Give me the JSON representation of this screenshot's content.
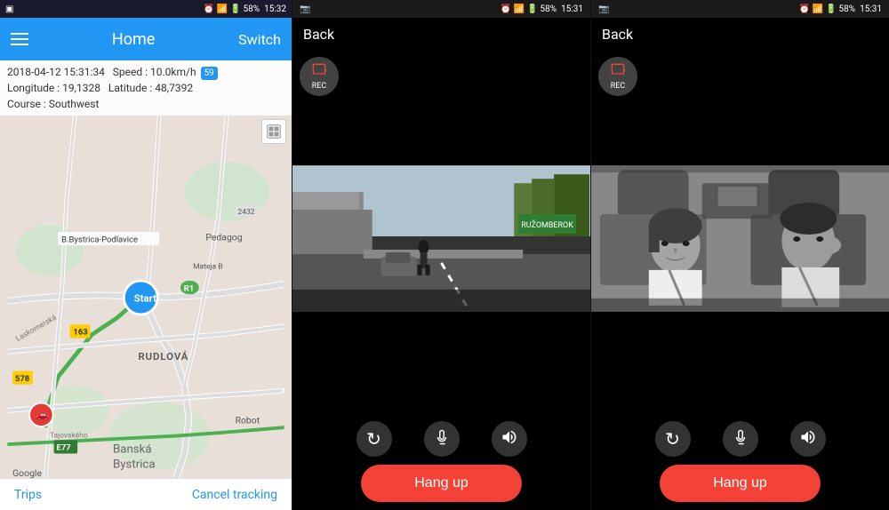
{
  "panel1": {
    "statusbar": {
      "left": "▣",
      "icons": "⏰ 📶 🔋 58%",
      "time": "15:32"
    },
    "topbar": {
      "title": "Home",
      "switch_label": "Switch"
    },
    "infobar": {
      "datetime": "2018-04-12  15:31:34",
      "speed_label": "Speed :",
      "speed_value": "10.0km/h",
      "longitude_label": "Longitude :",
      "longitude_value": "19,1328",
      "latitude_label": "Latitude :",
      "latitude_value": "48,7392",
      "course_label": "Course :",
      "course_value": "Southwest",
      "speed_badge": "59"
    },
    "map": {
      "start_label": "Start",
      "place_bystrica_podlavice": "B.Bystrica-Podlavice",
      "place_pedagog": "Pedagog",
      "place_rudlova": "RUDLOVÁ",
      "place_banska_bystrica": "Banská\nBystrica",
      "place_robotics": "Robot",
      "route_163": "163",
      "route_578": "578",
      "route_e77": "E77",
      "road_r1": "R1"
    },
    "bottom": {
      "trips_label": "Trips",
      "cancel_label": "Cancel tracking"
    }
  },
  "panel2": {
    "statusbar": {
      "camera_icon": "📷",
      "icons": "⏰ 📶 🔋 58%",
      "time": "15:31"
    },
    "topbar": {
      "back_label": "Back"
    },
    "rec_label": "REC",
    "controls": {
      "rotate_icon": "↻",
      "mic_icon": "🎤",
      "speaker_icon": "🔊"
    },
    "hang_up_label": "Hang up"
  },
  "panel3": {
    "statusbar": {
      "camera_icon": "📷",
      "icons": "⏰ 📶 🔋 58%",
      "time": "15:31"
    },
    "topbar": {
      "back_label": "Back"
    },
    "rec_label": "REC",
    "controls": {
      "rotate_icon": "↻",
      "mic_icon": "🎤",
      "speaker_icon": "🔊"
    },
    "hang_up_label": "Hang up"
  }
}
